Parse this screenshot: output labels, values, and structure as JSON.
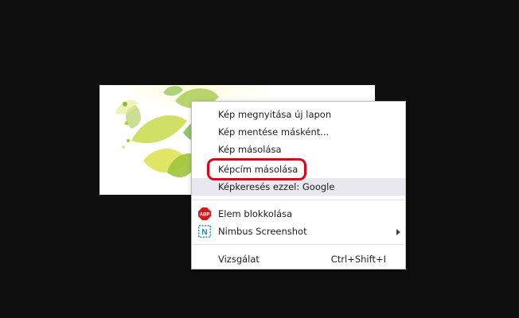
{
  "context_menu": {
    "items": [
      {
        "label": "Kép megnyitása új lapon"
      },
      {
        "label": "Kép mentése másként..."
      },
      {
        "label": "Kép másolása"
      },
      {
        "label": "Képcím másolása"
      },
      {
        "label": "Képkeresés ezzel: Google"
      },
      {
        "label": "Elem blokkolása",
        "icon": "abp-icon"
      },
      {
        "label": "Nimbus Screenshot",
        "icon": "nimbus-icon"
      },
      {
        "label": "Vizsgálat",
        "shortcut": "Ctrl+Shift+I"
      }
    ],
    "abp_icon_text": "ABP",
    "nimbus_icon_text": "N"
  },
  "colors": {
    "highlight_ring": "#e2001a",
    "hover_row": "#e8e8ee",
    "abp_red": "#d7161b",
    "nimbus_teal": "#1f8aa8"
  }
}
